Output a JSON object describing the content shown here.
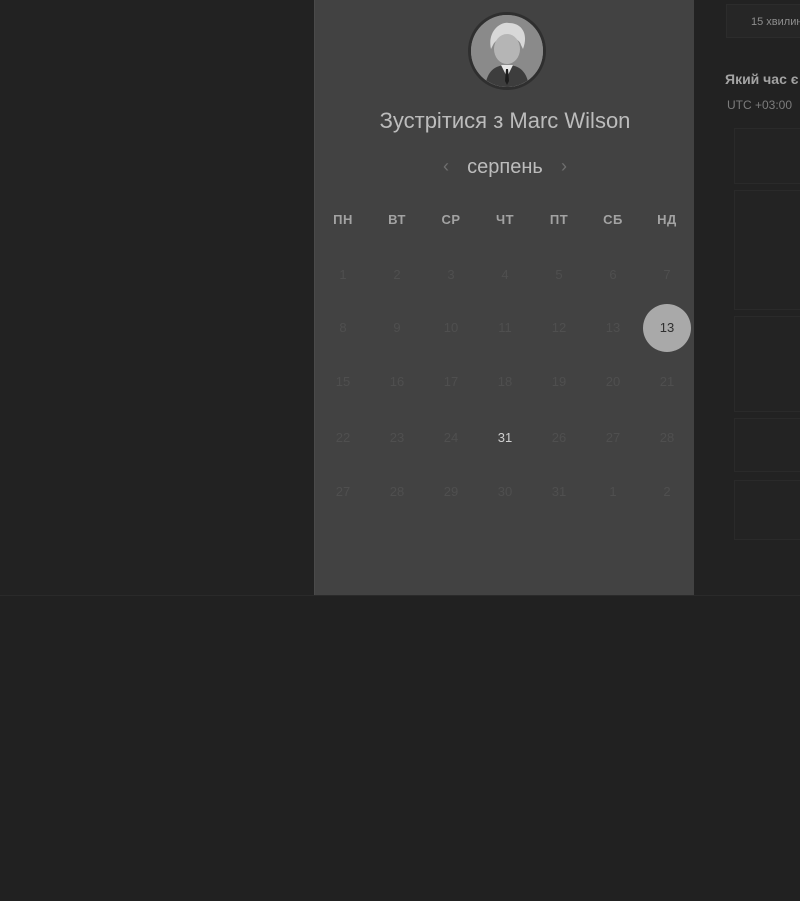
{
  "header": {
    "title": "Зустрітися з Marc Wilson"
  },
  "calendar": {
    "month_label": "серпень",
    "prev_icon": "chevron-left-icon",
    "next_icon": "chevron-right-icon",
    "weekdays": [
      "ПН",
      "ВТ",
      "СР",
      "ЧТ",
      "ПТ",
      "СБ",
      "НД"
    ],
    "weeks": [
      [
        {
          "label": "1",
          "state": "disabled"
        },
        {
          "label": "2",
          "state": "disabled"
        },
        {
          "label": "3",
          "state": "disabled"
        },
        {
          "label": "4",
          "state": "disabled"
        },
        {
          "label": "5",
          "state": "disabled"
        },
        {
          "label": "6",
          "state": "disabled"
        },
        {
          "label": "7",
          "state": "disabled"
        }
      ],
      [
        {
          "label": "8",
          "state": "disabled"
        },
        {
          "label": "9",
          "state": "disabled"
        },
        {
          "label": "10",
          "state": "disabled"
        },
        {
          "label": "11",
          "state": "disabled"
        },
        {
          "label": "12",
          "state": "disabled"
        },
        {
          "label": "13",
          "state": "disabled"
        },
        {
          "label": "13",
          "state": "selected"
        }
      ],
      [
        {
          "label": "15",
          "state": "disabled"
        },
        {
          "label": "16",
          "state": "disabled"
        },
        {
          "label": "17",
          "state": "disabled"
        },
        {
          "label": "18",
          "state": "disabled"
        },
        {
          "label": "19",
          "state": "disabled"
        },
        {
          "label": "20",
          "state": "disabled"
        },
        {
          "label": "21",
          "state": "disabled"
        }
      ],
      [
        {
          "label": "22",
          "state": "disabled"
        },
        {
          "label": "23",
          "state": "disabled"
        },
        {
          "label": "24",
          "state": "disabled"
        },
        {
          "label": "31",
          "state": "available"
        },
        {
          "label": "26",
          "state": "disabled"
        },
        {
          "label": "27",
          "state": "disabled"
        },
        {
          "label": "28",
          "state": "disabled"
        }
      ],
      [
        {
          "label": "27",
          "state": "disabled"
        },
        {
          "label": "28",
          "state": "disabled"
        },
        {
          "label": "29",
          "state": "disabled"
        },
        {
          "label": "30",
          "state": "disabled"
        },
        {
          "label": "31",
          "state": "disabled"
        },
        {
          "label": "1",
          "state": "disabled"
        },
        {
          "label": "2",
          "state": "disabled"
        }
      ]
    ]
  },
  "sidebar": {
    "duration_label": "15 хвилин",
    "tz_question": "Який час є",
    "tz_value": "UTC +03:00"
  },
  "colors": {
    "page_bg": "#222222",
    "panel_bg": "#424242",
    "selected_day_bg": "#a9a9a9",
    "text_primary": "#bcbcbc"
  }
}
